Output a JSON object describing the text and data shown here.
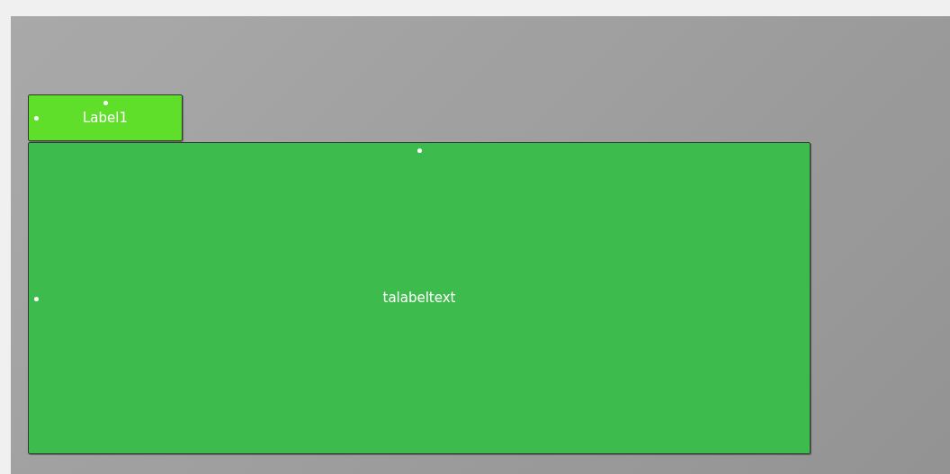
{
  "labels": [
    {
      "text": "Label1",
      "color": "#5fde2a",
      "kind": "small"
    },
    {
      "text": "talabeltext",
      "color": "#3dbc4d",
      "kind": "large"
    }
  ]
}
